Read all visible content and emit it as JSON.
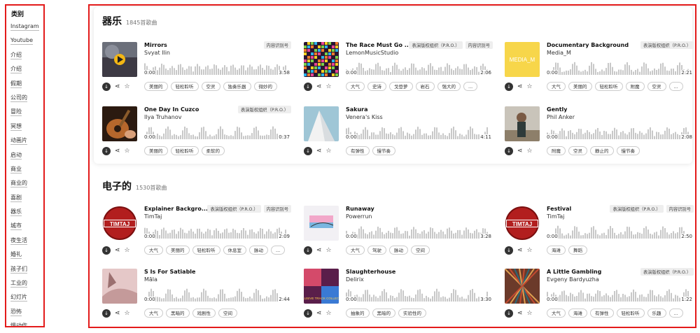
{
  "sidebar": {
    "heading": "类别",
    "items": [
      "Instagram",
      "Youtube",
      "介绍",
      "介绍",
      "假期",
      "公司的",
      "冒险",
      "冥想",
      "动画片",
      "启动",
      "商业",
      "商业的",
      "喜剧",
      "器乐",
      "城市",
      "夜生活",
      "婚礼",
      "孩子们",
      "工业的",
      "幻灯片",
      "恐怖",
      "慢动作"
    ]
  },
  "sections": [
    {
      "title": "器乐",
      "count": "1845首歌曲",
      "tracks": [
        {
          "title": "Mirrors",
          "artist": "Svyat Ilin",
          "badges": [
            "内容识别号"
          ],
          "start": "0:00",
          "end": "3:58",
          "tags": [
            "美丽的",
            "轻松聆听",
            "空灵",
            "独奏乐器",
            "微妙的"
          ],
          "art": "mirrors"
        },
        {
          "title": "The Race Must Go ...",
          "artist": "LemonMusicStudio",
          "badges": [
            "表演版权组织（P.R.O.）",
            "内容识别号"
          ],
          "start": "0:00",
          "end": "2:06",
          "tags": [
            "大气",
            "史诗",
            "戈登萝",
            "岩石",
            "强大的",
            "..."
          ],
          "art": "race"
        },
        {
          "title": "Documentary Background",
          "artist": "Media_M",
          "badges": [
            "表演版权组织（P.R.O.）"
          ],
          "start": "0:00",
          "end": "2:21",
          "tags": [
            "大气",
            "美丽的",
            "轻松聆听",
            "附魔",
            "空灵",
            "..."
          ],
          "art": "media"
        },
        {
          "title": "One Day In Cuzco",
          "artist": "Ilya Truhanov",
          "badges": [
            "表演版权组织（P.R.O.）"
          ],
          "start": "0:00",
          "end": "0:37",
          "tags": [
            "美丽的",
            "轻松聆听",
            "柔软的"
          ],
          "art": "guitar"
        },
        {
          "title": "Sakura",
          "artist": "Venera's Kiss",
          "badges": [],
          "start": "0:00",
          "end": "4:11",
          "tags": [
            "有弹性",
            "慢节奏"
          ],
          "art": "sakura"
        },
        {
          "title": "Gently",
          "artist": "Phil Anker",
          "badges": [],
          "start": "0:00",
          "end": "2:08",
          "tags": [
            "附魔",
            "空灵",
            "静止的",
            "慢节奏"
          ],
          "art": "gently"
        }
      ]
    },
    {
      "title": "电子的",
      "count": "1530首歌曲",
      "tracks": [
        {
          "title": "Explainer Backgro...",
          "artist": "TimTaj",
          "badges": [
            "表演版权组织（P.R.O.）",
            "内容识别号"
          ],
          "start": "0:00",
          "end": "2:09",
          "tags": [
            "大气",
            "美丽的",
            "轻松聆听",
            "休息室",
            "脉动",
            "..."
          ],
          "art": "timtaj"
        },
        {
          "title": "Runaway",
          "artist": "Powerrun",
          "badges": [],
          "start": "0:00",
          "end": "3:28",
          "tags": [
            "大气",
            "驾驶",
            "脉动",
            "空间"
          ],
          "art": "runaway"
        },
        {
          "title": "Festival",
          "artist": "TimTaj",
          "badges": [
            "表演版权组织（P.R.O.）",
            "内容识别号"
          ],
          "start": "0:00",
          "end": "2:50",
          "tags": [
            "海滩",
            "舞蹈"
          ],
          "art": "timtaj"
        },
        {
          "title": "S Is For Satiable",
          "artist": "Mãla",
          "badges": [],
          "start": "0:00",
          "end": "2:44",
          "tags": [
            "大气",
            "黑暗的",
            "戏剧性",
            "空间"
          ],
          "art": "satiable"
        },
        {
          "title": "Slaughterhouse",
          "artist": "Delirix",
          "badges": [],
          "start": "0:00",
          "end": "3:30",
          "tags": [
            "抽象的",
            "黑暗的",
            "实验性的"
          ],
          "art": "slaughter"
        },
        {
          "title": "A Little Gambling",
          "artist": "Evgeny Bardyuzha",
          "badges": [
            "表演版权组织（P.R.O.）"
          ],
          "start": "0:00",
          "end": "1:22",
          "tags": [
            "大气",
            "海滩",
            "有弹性",
            "轻松聆听",
            "乐趣",
            "..."
          ],
          "art": "gambling"
        }
      ]
    }
  ],
  "art_text": {
    "media": "MEDIA_M",
    "timtaj": "TIMTAJ",
    "slaughter": "EXCLUSIVE TRACK COLLECTION"
  },
  "icons": {
    "download": "download-icon",
    "share": "share-icon",
    "favorite": "star-icon",
    "play": "play-icon"
  },
  "colors": {
    "frame": "#e31b1b",
    "accent_yellow": "#f7d64a",
    "timtaj_red": "#b21e1e"
  }
}
